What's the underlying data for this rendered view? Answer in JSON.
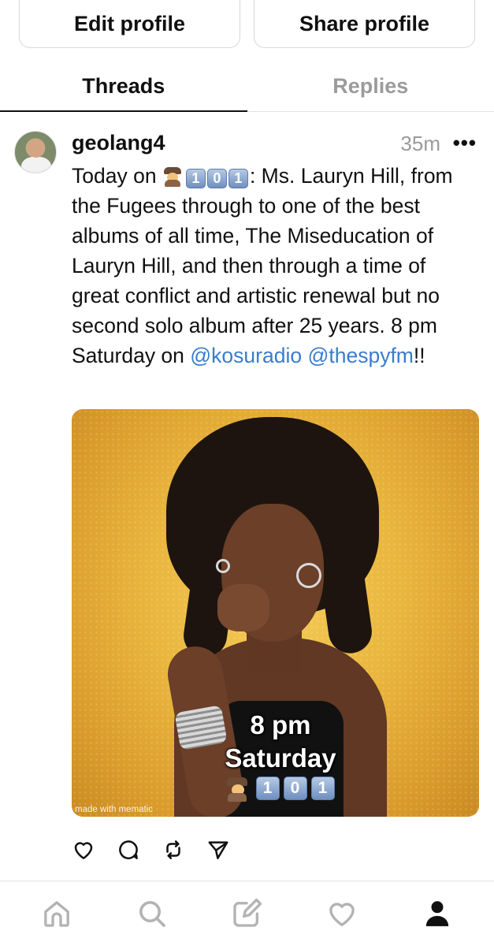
{
  "profile_actions": {
    "edit_label": "Edit profile",
    "share_label": "Share profile"
  },
  "tabs": [
    {
      "label": "Threads",
      "active": true
    },
    {
      "label": "Replies",
      "active": false
    }
  ],
  "post": {
    "username": "geolang4",
    "timestamp": "35m",
    "more_label": "•••",
    "text_prefix": "Today on",
    "emoji_icons": [
      "detective-emoji",
      "keycap-1-emoji",
      "keycap-0-emoji",
      "keycap-1-emoji"
    ],
    "keycaps": [
      "1",
      "0",
      "1"
    ],
    "text_body": ": Ms. Lauryn Hill, from the Fugees through to one of the best albums of all time, The Miseducation of Lauryn Hill, and then through a time of great conflict and artistic renewal but no second solo album after 25 years. 8 pm Saturday on ",
    "mentions": [
      "@kosuradio",
      "@thespyfm"
    ],
    "text_suffix": "!!",
    "media": {
      "caption_line1": "8 pm",
      "caption_line2": "Saturday",
      "caption_keycaps": [
        "1",
        "0",
        "1"
      ],
      "watermark": "made with mematic"
    },
    "action_icons": [
      "heart-icon",
      "comment-icon",
      "repost-icon",
      "share-icon"
    ]
  },
  "bottom_nav": {
    "items": [
      "home-icon",
      "search-icon",
      "compose-icon",
      "activity-heart-icon",
      "profile-icon"
    ],
    "active": "profile-icon"
  },
  "colors": {
    "mention": "#3a7ccd",
    "muted": "#9a9a9a",
    "text": "#101010",
    "divider": "#e3e3e3"
  }
}
